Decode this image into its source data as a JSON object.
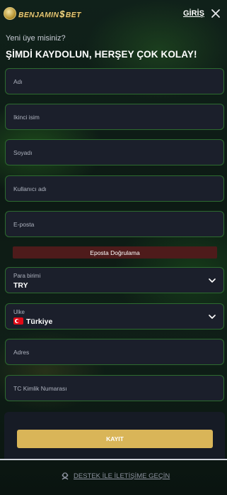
{
  "header": {
    "logo_text_left": "BENJAMIN",
    "logo_symbol": "$",
    "logo_text_right": "BET",
    "login_label": "GİRİŞ"
  },
  "intro": {
    "question": "Yeni üye misiniz?",
    "headline": "ŞİMDİ KAYDOLUN, HERŞEY ÇOK KOLAY!"
  },
  "form": {
    "first_name_placeholder": "Adı",
    "middle_name_placeholder": "Ikinci isim",
    "last_name_placeholder": "Soyadı",
    "username_placeholder": "Kullanıcı adı",
    "email_placeholder": "E-posta",
    "email_verify_label": "Eposta Doğrulama",
    "currency_label": "Para birimi",
    "currency_value": "TRY",
    "country_label": "Ulke",
    "country_value": "Türkiye",
    "address_placeholder": "Adres",
    "tc_placeholder": "TC Kimlik Numarası",
    "submit_label": "KAYIT"
  },
  "footer": {
    "support_label": "DESTEK İLE İLETİŞİME GEÇİN"
  },
  "colors": {
    "field_border": "#2d6b2f",
    "field_bg": "#1b1f2b",
    "verify_bg": "#4e1b1b",
    "submit_bg": "#d9b558",
    "brand_gold": "#e2c877"
  },
  "icons": {
    "close": "close-icon",
    "chevron": "chevron-down-icon",
    "support": "support-agent-icon",
    "flag": "turkey-flag-icon"
  }
}
